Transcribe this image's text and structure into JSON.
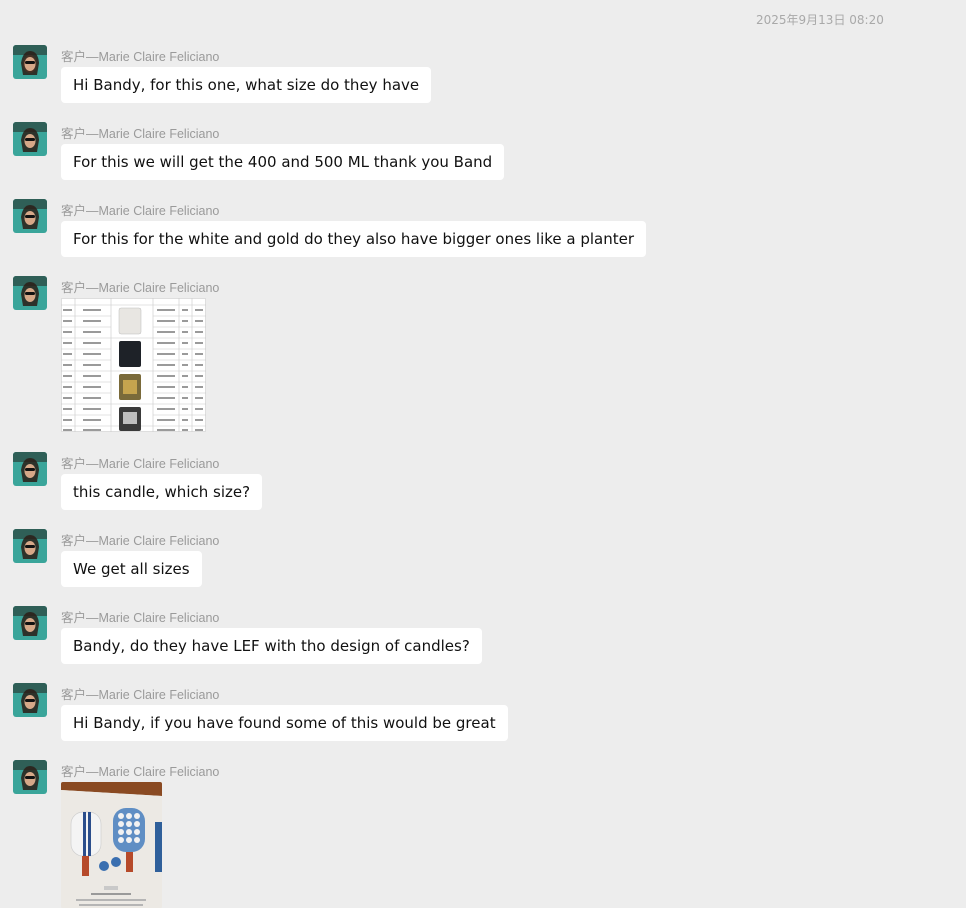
{
  "timestamp": "2025年9月13日 08:20",
  "messages": [
    {
      "sender": "客户—Marie Claire Feliciano",
      "text": "Hi Bandy, for this one, what size do they have"
    },
    {
      "sender": "客户—Marie Claire Feliciano",
      "text": "For this we will get the 400 and 500 ML thank you Band"
    },
    {
      "sender": "客户—Marie Claire Feliciano",
      "text": "For this for the white and gold  do they also have bigger ones like a planter"
    },
    {
      "sender": "客户—Marie Claire Feliciano",
      "image": "candle-product-table"
    },
    {
      "sender": "客户—Marie Claire Feliciano",
      "text": "this candle, which size?"
    },
    {
      "sender": "客户—Marie Claire Feliciano",
      "text": "We get all sizes"
    },
    {
      "sender": "客户—Marie Claire Feliciano",
      "text": "Bandy, do they have LEF with tho design of candles?"
    },
    {
      "sender": "客户—Marie Claire Feliciano",
      "text": "Hi Bandy, if you have found some of this would be great"
    },
    {
      "sender": "客户—Marie Claire Feliciano",
      "image": "pickleball-paddle-photo"
    }
  ],
  "colors": {
    "background": "#ededed",
    "bubble": "#ffffff",
    "sender_text": "#9a9a9a",
    "message_text": "#111111"
  }
}
